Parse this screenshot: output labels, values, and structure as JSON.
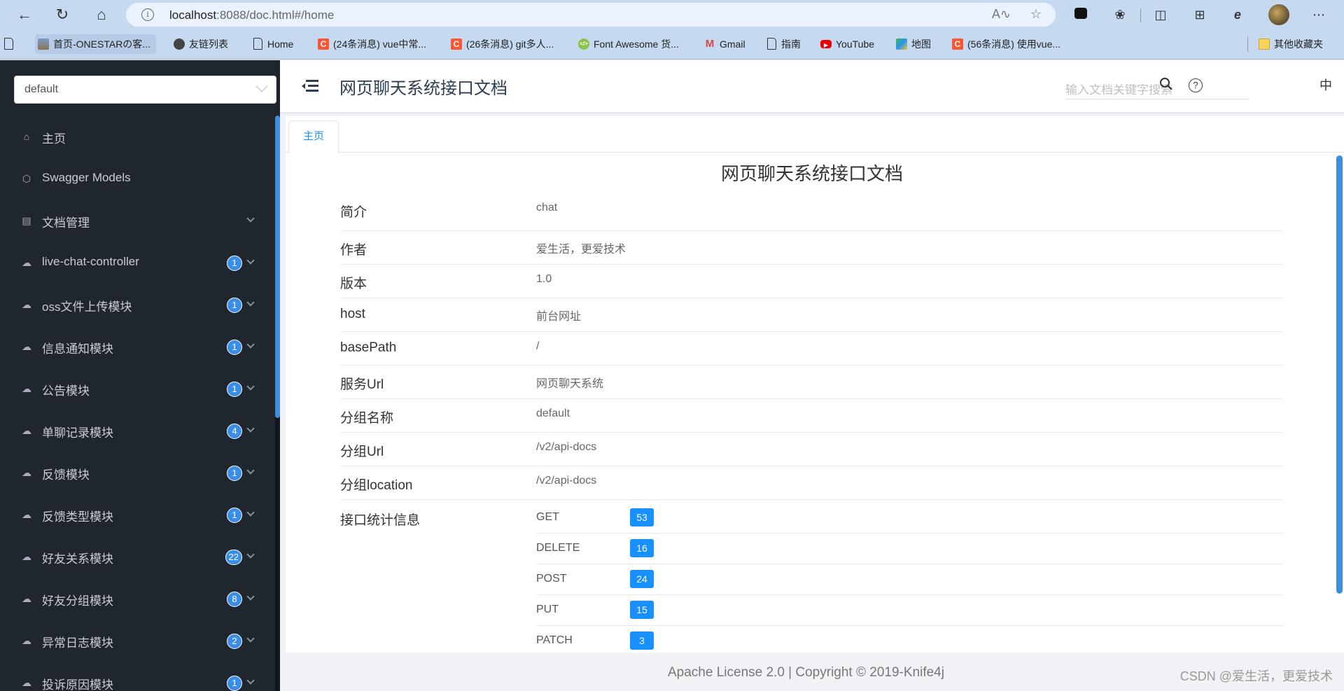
{
  "browser": {
    "url_host": "localhost",
    "url_rest": ":8088/doc.html#/home",
    "bookmarks": [
      {
        "label": "",
        "icon": "doc"
      },
      {
        "label": "首页-ONESTARの客...",
        "icon": "img"
      },
      {
        "label": "友链列表",
        "icon": "user"
      },
      {
        "label": "Home",
        "icon": "doc"
      },
      {
        "label": "(24条消息) vue中常...",
        "icon": "csdn"
      },
      {
        "label": "(26条消息) git多人...",
        "icon": "csdn"
      },
      {
        "label": "Font Awesome 货...",
        "icon": "fa"
      },
      {
        "label": "Gmail",
        "icon": "gmail"
      },
      {
        "label": "指南",
        "icon": "doc"
      },
      {
        "label": "YouTube",
        "icon": "yt"
      },
      {
        "label": "地图",
        "icon": "map"
      },
      {
        "label": "(56条消息) 使用vue...",
        "icon": "csdn"
      },
      {
        "label": "其他收藏夹",
        "icon": "folder"
      }
    ]
  },
  "sidebar": {
    "group_select": "default",
    "items": [
      {
        "label": "主页",
        "icon": "home-icon",
        "badge": null,
        "expandable": false
      },
      {
        "label": "Swagger Models",
        "icon": "model-icon",
        "badge": null,
        "expandable": false
      },
      {
        "label": "文档管理",
        "icon": "doc-settings-icon",
        "badge": null,
        "expandable": true
      },
      {
        "label": "live-chat-controller",
        "icon": "api-cloud-icon",
        "badge": "1",
        "expandable": true
      },
      {
        "label": "oss文件上传模块",
        "icon": "api-cloud-icon",
        "badge": "1",
        "expandable": true
      },
      {
        "label": "信息通知模块",
        "icon": "api-cloud-icon",
        "badge": "1",
        "expandable": true
      },
      {
        "label": "公告模块",
        "icon": "api-cloud-icon",
        "badge": "1",
        "expandable": true
      },
      {
        "label": "单聊记录模块",
        "icon": "api-cloud-icon",
        "badge": "4",
        "expandable": true
      },
      {
        "label": "反馈模块",
        "icon": "api-cloud-icon",
        "badge": "1",
        "expandable": true
      },
      {
        "label": "反馈类型模块",
        "icon": "api-cloud-icon",
        "badge": "1",
        "expandable": true
      },
      {
        "label": "好友关系模块",
        "icon": "api-cloud-icon",
        "badge": "22",
        "expandable": true
      },
      {
        "label": "好友分组模块",
        "icon": "api-cloud-icon",
        "badge": "8",
        "expandable": true
      },
      {
        "label": "异常日志模块",
        "icon": "api-cloud-icon",
        "badge": "2",
        "expandable": true
      },
      {
        "label": "投诉原因模块",
        "icon": "api-cloud-icon",
        "badge": "1",
        "expandable": true
      }
    ]
  },
  "header": {
    "title": "网页聊天系统接口文档",
    "search_placeholder": "输入文档关键字搜索",
    "lang": "中"
  },
  "tabs": [
    {
      "label": "主页",
      "active": true
    }
  ],
  "doc": {
    "title": "网页聊天系统接口文档",
    "rows": [
      {
        "key": "简介",
        "value": "chat"
      },
      {
        "key": "作者",
        "value": "爱生活，更爱技术"
      },
      {
        "key": "版本",
        "value": "1.0"
      },
      {
        "key": "host",
        "value": "前台网址"
      },
      {
        "key": "basePath",
        "value": "/"
      },
      {
        "key": "服务Url",
        "value": "网页聊天系统"
      },
      {
        "key": "分组名称",
        "value": "default"
      },
      {
        "key": "分组Url",
        "value": "/v2/api-docs"
      },
      {
        "key": "分组location",
        "value": "/v2/api-docs"
      }
    ],
    "stats_label": "接口统计信息",
    "stats": [
      {
        "method": "GET",
        "count": "53"
      },
      {
        "method": "DELETE",
        "count": "16"
      },
      {
        "method": "POST",
        "count": "24"
      },
      {
        "method": "PUT",
        "count": "15"
      },
      {
        "method": "PATCH",
        "count": "3"
      }
    ]
  },
  "footer": {
    "license": "Apache License 2.0 | Copyright © 2019-Knife4j",
    "watermark": "CSDN @爱生活，更爱技术"
  },
  "colors": {
    "sidebar_bg": "#1f262d",
    "accent": "#1890ff",
    "badge_blue": "#3a8ee6"
  }
}
